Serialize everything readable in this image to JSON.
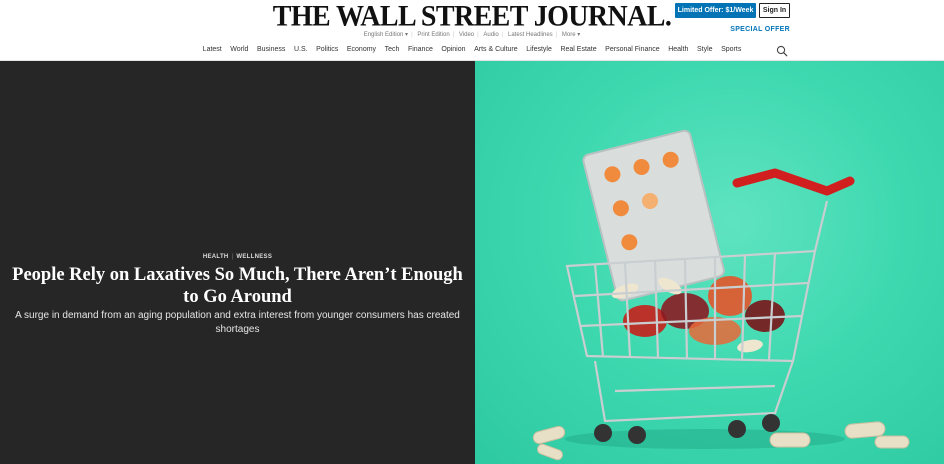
{
  "header": {
    "masthead": "THE WALL STREET JOURNAL.",
    "offer_button": "Limited Offer: $1/Week",
    "signin_button": "Sign In",
    "special_offer": "SPECIAL OFFER",
    "edition_links": [
      "English Edition ▾",
      "Print Edition",
      "Video",
      "Audio",
      "Latest Headlines",
      "More ▾"
    ],
    "nav": [
      "Latest",
      "World",
      "Business",
      "U.S.",
      "Politics",
      "Economy",
      "Tech",
      "Finance",
      "Opinion",
      "Arts & Culture",
      "Lifestyle",
      "Real Estate",
      "Personal Finance",
      "Health",
      "Style",
      "Sports"
    ],
    "search_icon": "search-icon",
    "accent_color": "#0274b6"
  },
  "hero": {
    "kicker_primary": "HEALTH",
    "kicker_secondary": "WELLNESS",
    "headline": "People Rely on Laxatives So Much, There Aren’t Enough to Go Around",
    "dek": "A surge in demand from an aging population and extra interest from younger consumers has created shortages",
    "background_color": "#262626",
    "image_background_color": "#3fd9b0"
  }
}
